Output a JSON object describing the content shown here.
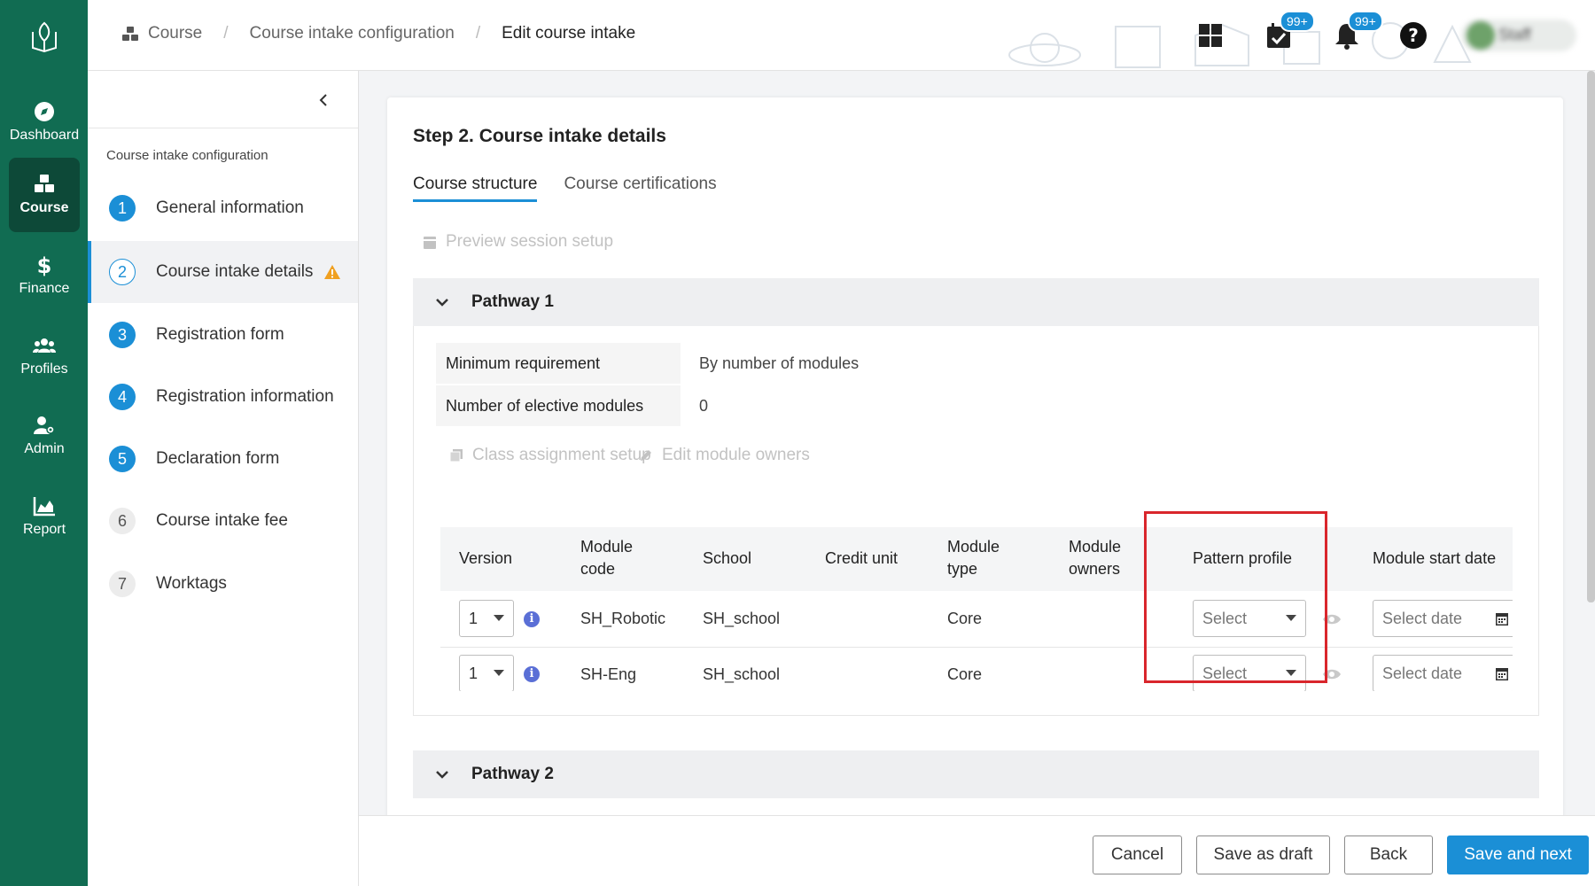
{
  "nav": {
    "logo_icon": "leaf-book-logo-icon",
    "items": [
      {
        "label": "Dashboard",
        "icon": "compass-icon"
      },
      {
        "label": "Course",
        "icon": "cubes-icon"
      },
      {
        "label": "Finance",
        "icon": "dollar-icon"
      },
      {
        "label": "Profiles",
        "icon": "users-icon"
      },
      {
        "label": "Admin",
        "icon": "user-gear-icon"
      },
      {
        "label": "Report",
        "icon": "area-chart-icon"
      }
    ],
    "active_item": "Course"
  },
  "breadcrumb": {
    "items": [
      "Course",
      "Course intake configuration",
      "Edit course intake"
    ]
  },
  "topbar": {
    "tasks_badge": "99+",
    "notifications_badge": "99+",
    "user_name": "Staff"
  },
  "steps_panel": {
    "title": "Course intake configuration",
    "steps": [
      {
        "num": "1",
        "label": "General information",
        "state": "done"
      },
      {
        "num": "2",
        "label": "Course intake details",
        "state": "current-warning"
      },
      {
        "num": "3",
        "label": "Registration form",
        "state": "done"
      },
      {
        "num": "4",
        "label": "Registration information",
        "state": "done"
      },
      {
        "num": "5",
        "label": "Declaration form",
        "state": "done"
      },
      {
        "num": "6",
        "label": "Course intake fee",
        "state": "pending"
      },
      {
        "num": "7",
        "label": "Worktags",
        "state": "pending"
      }
    ]
  },
  "main": {
    "title": "Step 2. Course intake details",
    "tabs": [
      "Course structure",
      "Course certifications"
    ],
    "active_tab": "Course structure",
    "preview_link": "Preview session setup",
    "pathways": [
      {
        "title": "Pathway 1",
        "min_req_label": "Minimum requirement",
        "min_req_value": "By number of modules",
        "elective_label": "Number of elective modules",
        "elective_value": "0",
        "class_assign_link": "Class assignment setup",
        "edit_owners_link": "Edit module owners",
        "columns": [
          "Version",
          "Module code",
          "School",
          "Credit unit",
          "Module type",
          "Module owners",
          "Pattern profile",
          "Module start date"
        ],
        "rows": [
          {
            "version": "1",
            "code": "SH_Robotic",
            "school": "SH_school",
            "credit": "",
            "type": "Core",
            "owners": "",
            "pattern": "Select",
            "start_date_placeholder": "Select date"
          },
          {
            "version": "1",
            "code": "SH-Eng",
            "school": "SH_school",
            "credit": "",
            "type": "Core",
            "owners": "",
            "pattern": "Select",
            "start_date_placeholder": "Select date"
          }
        ]
      },
      {
        "title": "Pathway 2"
      }
    ]
  },
  "footer": {
    "cancel": "Cancel",
    "save_draft": "Save as draft",
    "back": "Back",
    "save_next": "Save and next"
  },
  "colors": {
    "nav_bg": "#116c52",
    "nav_active": "#0d4938",
    "accent": "#1b8fd6",
    "highlight": "#d9262c",
    "warning": "#f0a020"
  }
}
